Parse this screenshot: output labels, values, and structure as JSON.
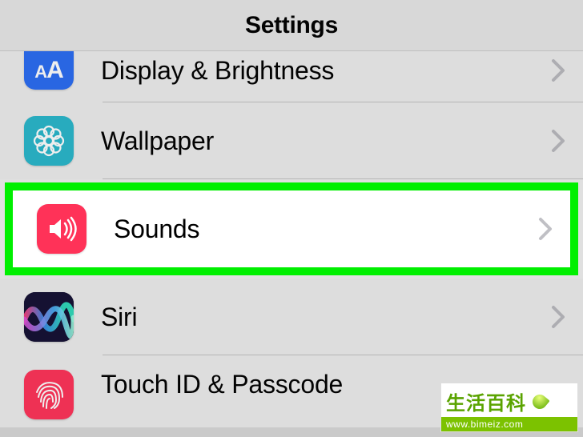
{
  "header": {
    "title": "Settings"
  },
  "rows": {
    "display": {
      "label": "Display & Brightness",
      "icon": "display-text-size-icon"
    },
    "wallpaper": {
      "label": "Wallpaper",
      "icon": "wallpaper-flower-icon"
    },
    "sounds": {
      "label": "Sounds",
      "icon": "speaker-icon"
    },
    "siri": {
      "label": "Siri",
      "icon": "siri-wave-icon"
    },
    "touchid": {
      "label": "Touch ID & Passcode",
      "icon": "fingerprint-icon"
    }
  },
  "highlighted_row": "sounds",
  "watermark": {
    "text_cn": "生活百科",
    "url": "www.bimeiz.com"
  }
}
